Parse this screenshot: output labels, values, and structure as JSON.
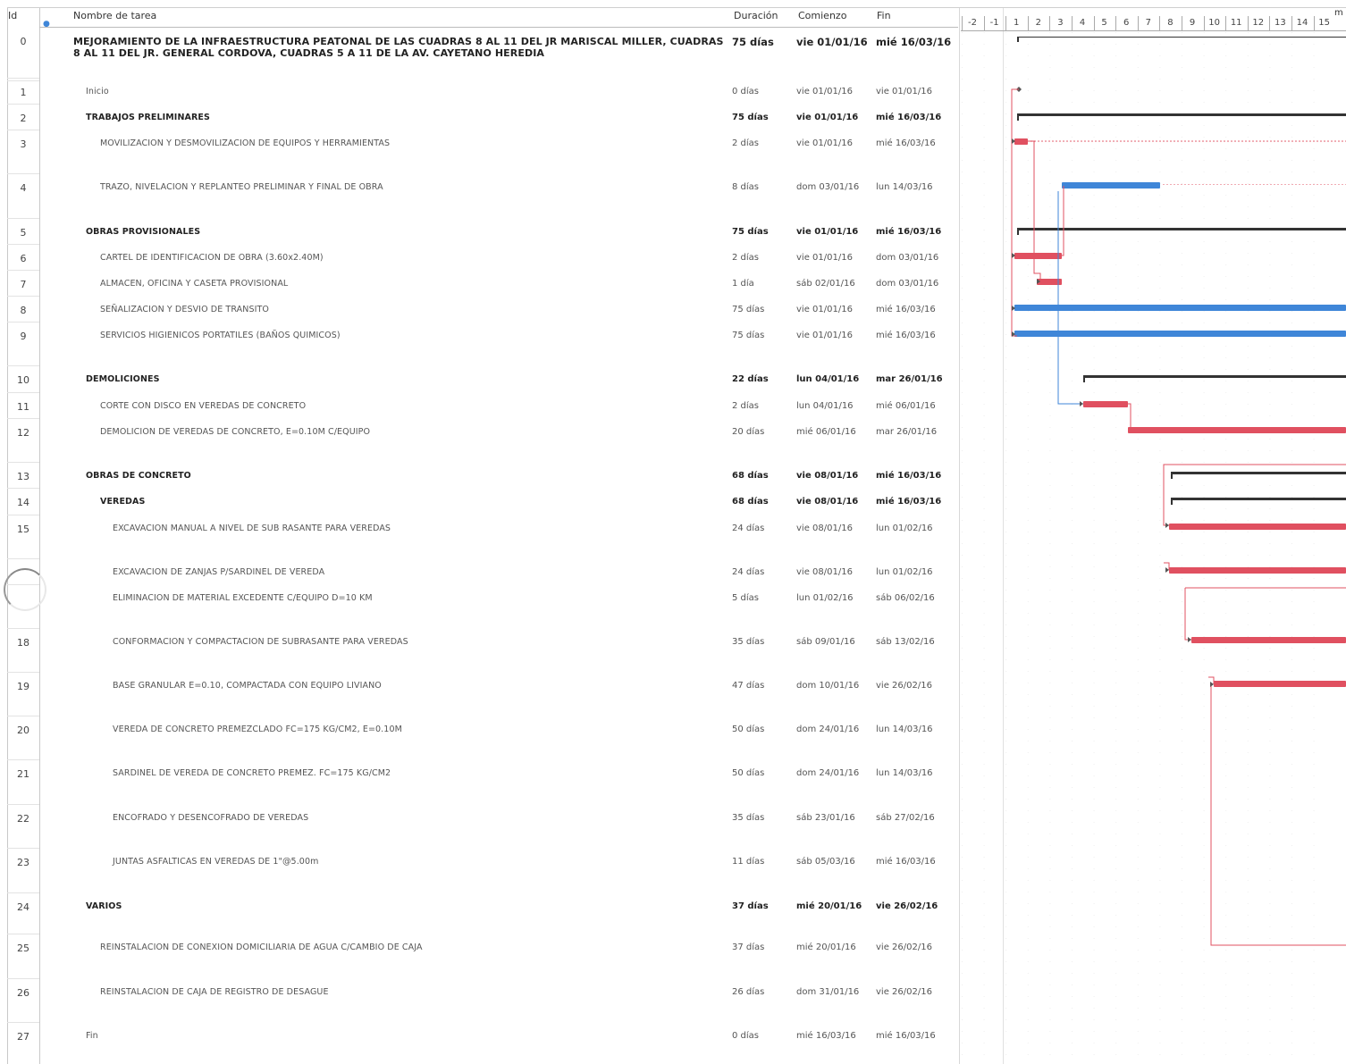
{
  "header": {
    "id": "Id",
    "name": "Nombre de tarea",
    "duration": "Duración",
    "start": "Comienzo",
    "finish": "Fin",
    "corner": "m"
  },
  "timescale": [
    "-2",
    "-1",
    "1",
    "2",
    "3",
    "4",
    "5",
    "6",
    "7",
    "8",
    "9",
    "10",
    "11",
    "12",
    "13",
    "14",
    "15"
  ],
  "colors": {
    "critical": "#e05060",
    "normal": "#3f86d8",
    "summary": "#333333",
    "link_critical": "#e05060",
    "link_normal": "#3f86d8"
  },
  "tasks": [
    {
      "id": "0",
      "name": "MEJORAMIENTO DE LA INFRAESTRUCTURA PEATONAL DE LAS CUADRAS 8 AL 11 DEL JR MARISCAL MILLER, CUADRAS 8 AL 11 DEL JR. GENERAL CORDOVA, CUADRAS 5 A 11 DE LA AV. CAYETANO HEREDIA",
      "duration": "75 días",
      "start": "vie 01/01/16",
      "finish": "mié 16/03/16"
    },
    {
      "id": "1",
      "name": "Inicio",
      "duration": "0 días",
      "start": "vie 01/01/16",
      "finish": "vie 01/01/16"
    },
    {
      "id": "2",
      "name": "TRABAJOS PRELIMINARES",
      "duration": "75 días",
      "start": "vie 01/01/16",
      "finish": "mié 16/03/16"
    },
    {
      "id": "3",
      "name": "MOVILIZACION Y DESMOVILIZACION DE EQUIPOS Y HERRAMIENTAS",
      "duration": "2 días",
      "start": "vie 01/01/16",
      "finish": "mié 16/03/16"
    },
    {
      "id": "4",
      "name": "TRAZO, NIVELACION Y REPLANTEO PRELIMINAR Y FINAL DE OBRA",
      "duration": "8 días",
      "start": "dom 03/01/16",
      "finish": "lun 14/03/16"
    },
    {
      "id": "5",
      "name": "OBRAS PROVISIONALES",
      "duration": "75 días",
      "start": "vie 01/01/16",
      "finish": "mié 16/03/16"
    },
    {
      "id": "6",
      "name": "CARTEL DE IDENTIFICACION DE OBRA (3.60x2.40M)",
      "duration": "2 días",
      "start": "vie 01/01/16",
      "finish": "dom 03/01/16"
    },
    {
      "id": "7",
      "name": "ALMACEN, OFICINA Y CASETA PROVISIONAL",
      "duration": "1 día",
      "start": "sáb 02/01/16",
      "finish": "dom 03/01/16"
    },
    {
      "id": "8",
      "name": "SEÑALIZACION Y DESVIO DE TRANSITO",
      "duration": "75 días",
      "start": "vie 01/01/16",
      "finish": "mié 16/03/16"
    },
    {
      "id": "9",
      "name": "SERVICIOS HIGIENICOS PORTATILES (BAÑOS QUIMICOS)",
      "duration": "75 días",
      "start": "vie 01/01/16",
      "finish": "mié 16/03/16"
    },
    {
      "id": "10",
      "name": "DEMOLICIONES",
      "duration": "22 días",
      "start": "lun 04/01/16",
      "finish": "mar 26/01/16"
    },
    {
      "id": "11",
      "name": "CORTE CON DISCO EN VEREDAS DE CONCRETO",
      "duration": "2 días",
      "start": "lun 04/01/16",
      "finish": "mié 06/01/16"
    },
    {
      "id": "12",
      "name": "DEMOLICION DE VEREDAS DE CONCRETO, E=0.10M C/EQUIPO",
      "duration": "20 días",
      "start": "mié 06/01/16",
      "finish": "mar 26/01/16"
    },
    {
      "id": "13",
      "name": "OBRAS DE CONCRETO",
      "duration": "68 días",
      "start": "vie 08/01/16",
      "finish": "mié 16/03/16"
    },
    {
      "id": "14",
      "name": "VEREDAS",
      "duration": "68 días",
      "start": "vie 08/01/16",
      "finish": "mié 16/03/16"
    },
    {
      "id": "15",
      "name": "EXCAVACION MANUAL A NIVEL DE SUB RASANTE PARA VEREDAS",
      "duration": "24 días",
      "start": "vie 08/01/16",
      "finish": "lun 01/02/16"
    },
    {
      "id": "",
      "name": "EXCAVACION DE ZANJAS P/SARDINEL DE VEREDA",
      "duration": "24 días",
      "start": "vie 08/01/16",
      "finish": "lun 01/02/16"
    },
    {
      "id": "",
      "name": "ELIMINACION DE MATERIAL EXCEDENTE C/EQUIPO D=10 KM",
      "duration": "5 días",
      "start": "lun 01/02/16",
      "finish": "sáb 06/02/16"
    },
    {
      "id": "18",
      "name": "CONFORMACION Y COMPACTACION DE SUBRASANTE PARA VEREDAS",
      "duration": "35 días",
      "start": "sáb 09/01/16",
      "finish": "sáb 13/02/16"
    },
    {
      "id": "19",
      "name": "BASE GRANULAR E=0.10, COMPACTADA CON EQUIPO LIVIANO",
      "duration": "47 días",
      "start": "dom 10/01/16",
      "finish": "vie 26/02/16"
    },
    {
      "id": "20",
      "name": "VEREDA DE CONCRETO PREMEZCLADO FC=175 KG/CM2, E=0.10M",
      "duration": "50 días",
      "start": "dom 24/01/16",
      "finish": "lun 14/03/16"
    },
    {
      "id": "21",
      "name": "SARDINEL DE VEREDA DE CONCRETO PREMEZ. FC=175 KG/CM2",
      "duration": "50 días",
      "start": "dom 24/01/16",
      "finish": "lun 14/03/16"
    },
    {
      "id": "22",
      "name": "ENCOFRADO Y DESENCOFRADO DE VEREDAS",
      "duration": "35 días",
      "start": "sáb 23/01/16",
      "finish": "sáb 27/02/16"
    },
    {
      "id": "23",
      "name": "JUNTAS ASFALTICAS EN VEREDAS DE 1\"@5.00m",
      "duration": "11 días",
      "start": "sáb 05/03/16",
      "finish": "mié 16/03/16"
    },
    {
      "id": "24",
      "name": "VARIOS",
      "duration": "37 días",
      "start": "mié 20/01/16",
      "finish": "vie 26/02/16"
    },
    {
      "id": "25",
      "name": "REINSTALACION DE CONEXION DOMICILIARIA DE AGUA C/CAMBIO DE CAJA",
      "duration": "37 días",
      "start": "mié 20/01/16",
      "finish": "vie 26/02/16"
    },
    {
      "id": "26",
      "name": "REINSTALACION DE CAJA DE REGISTRO DE DESAGUE",
      "duration": "26 días",
      "start": "dom 31/01/16",
      "finish": "vie 26/02/16"
    },
    {
      "id": "27",
      "name": "Fin",
      "duration": "0 días",
      "start": "mié 16/03/16",
      "finish": "mié 16/03/16"
    }
  ]
}
